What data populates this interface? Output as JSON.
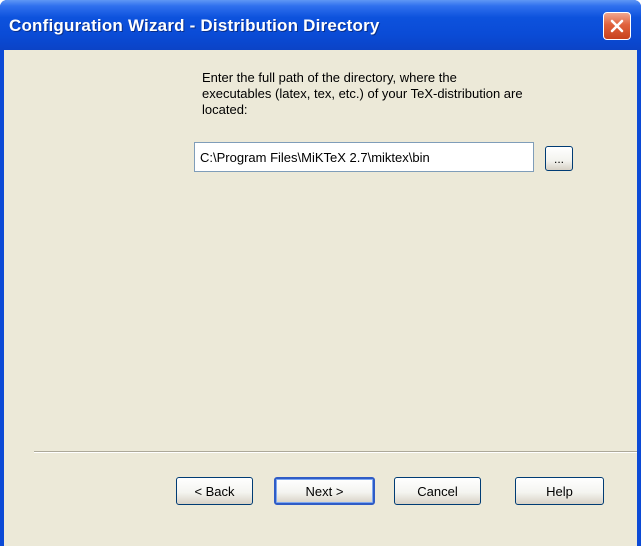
{
  "window": {
    "title": "Configuration Wizard - Distribution Directory",
    "close_icon": "close-icon"
  },
  "content": {
    "prompt_lines": [
      "Enter the full path of the directory, where the",
      "executables (latex, tex, etc.) of your TeX-distribution are",
      "located:"
    ],
    "path_value": "C:\\Program Files\\MiKTeX 2.7\\miktex\\bin",
    "browse_label": "..."
  },
  "buttons": {
    "back": "< Back",
    "next": "Next >",
    "cancel": "Cancel",
    "help": "Help"
  },
  "colors": {
    "titlebar": "#0b4ad6",
    "client": "#ece9d8",
    "close_button": "#e0623c"
  }
}
